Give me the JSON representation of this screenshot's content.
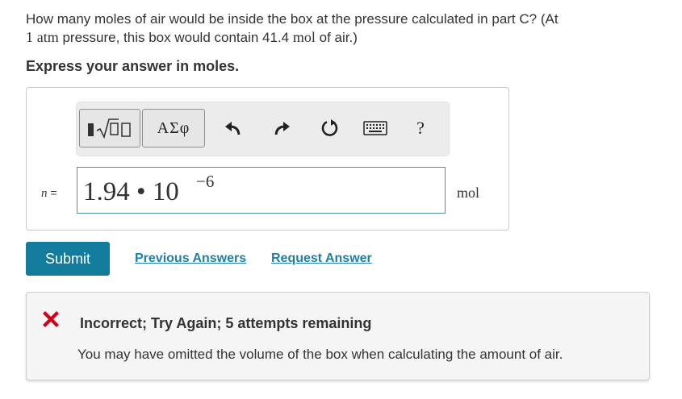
{
  "question": {
    "part1": "How many moles of air would be inside the box at the pressure calculated in part C? (At",
    "pressure_value": "1",
    "pressure_unit": "atm",
    "part2": " pressure, this box would contain ",
    "amount_value": "41.4",
    "amount_unit": "mol",
    "part3": " of air.)"
  },
  "instruction": "Express your answer in moles.",
  "toolbar": {
    "templates_icon": "templates-radical-icon",
    "greek_label": "ΑΣφ",
    "icons": [
      "undo-icon",
      "redo-icon",
      "reset-icon",
      "keyboard-icon",
      "help-icon"
    ],
    "help_label": "?"
  },
  "answer": {
    "variable": "n",
    "equals": "=",
    "mantissa": "1.94 • 10",
    "exponent": "−6",
    "unit": "mol"
  },
  "actions": {
    "submit": "Submit",
    "previous_answers": "Previous Answers",
    "request_answer": "Request Answer"
  },
  "feedback": {
    "status_icon": "incorrect-x-icon",
    "status_color": "#d0021b",
    "title": "Incorrect; Try Again; 5 attempts remaining",
    "message": "You may have omitted the volume of the box when calculating the amount of air."
  },
  "colors": {
    "accent": "#137b9b",
    "link": "#1f7fa6",
    "input_border": "#4f8fa8"
  }
}
